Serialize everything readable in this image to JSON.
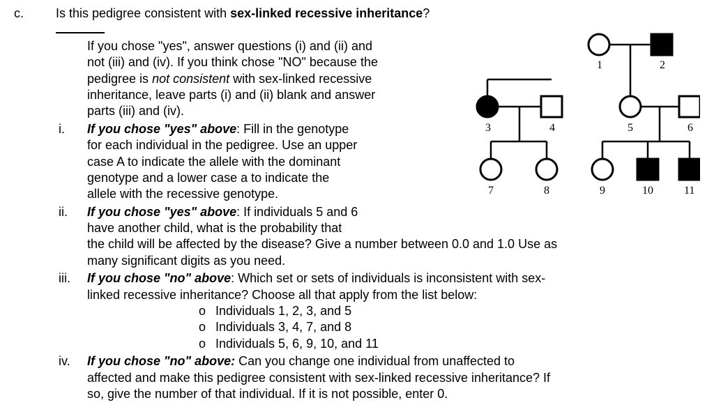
{
  "q": {
    "letter": "c.",
    "main": "Is this pedigree consistent with ",
    "main_bold": "sex-linked recessive inheritance",
    "main_end": "?",
    "intro_l1": "If you chose \"yes\", answer questions (i) and (ii) and",
    "intro_l2": "not (iii) and (iv). If you think chose \"NO\" because the",
    "intro_l3": "pedigree is ",
    "intro_l3_i": "not consistent",
    "intro_l3b": " with sex-linked recessive",
    "intro_l4": "inheritance, leave parts (i) and (ii) blank and answer",
    "intro_l5": "parts (iii) and (iv).",
    "i": {
      "num": "i.",
      "lead": "If you chose \"yes\" above",
      "text1": ": Fill in the genotype",
      "text2": "for each individual in the pedigree. Use an upper",
      "text3": "case A to indicate the allele with the dominant",
      "text4": "genotype and a lower case a to indicate the",
      "text5": "allele with the recessive genotype."
    },
    "ii": {
      "num": "ii.",
      "lead": "If you chose \"yes\" above",
      "text1": ": If individuals 5 and 6",
      "text2": "have another child, what is the probability that",
      "text3": "the child will be affected by the disease? Give a number between 0.0 and 1.0 Use as",
      "text4": "many significant digits as you need."
    },
    "iii": {
      "num": "iii.",
      "lead": "If you chose \"no\" above",
      "text1": ": Which set or sets of individuals is inconsistent with sex-",
      "text2": "linked recessive inheritance? Choose all that apply from the list below:",
      "opt1": "Individuals 1, 2, 3, and 5",
      "opt2": "Individuals 3, 4, 7, and 8",
      "opt3": "Individuals 5, 6, 9, 10, and 11"
    },
    "iv": {
      "num": "iv.",
      "lead": "If you chose \"no\" above:",
      "text1": " Can you change one individual from unaffected to",
      "text2": "affected and make this pedigree consistent with sex-linked recessive inheritance? If",
      "text3": "so, give the number of that individual. If it is not possible, enter 0."
    }
  },
  "bullet": "o",
  "pedigree": {
    "labels": [
      "1",
      "2",
      "3",
      "4",
      "5",
      "6",
      "7",
      "8",
      "9",
      "10",
      "11"
    ]
  }
}
